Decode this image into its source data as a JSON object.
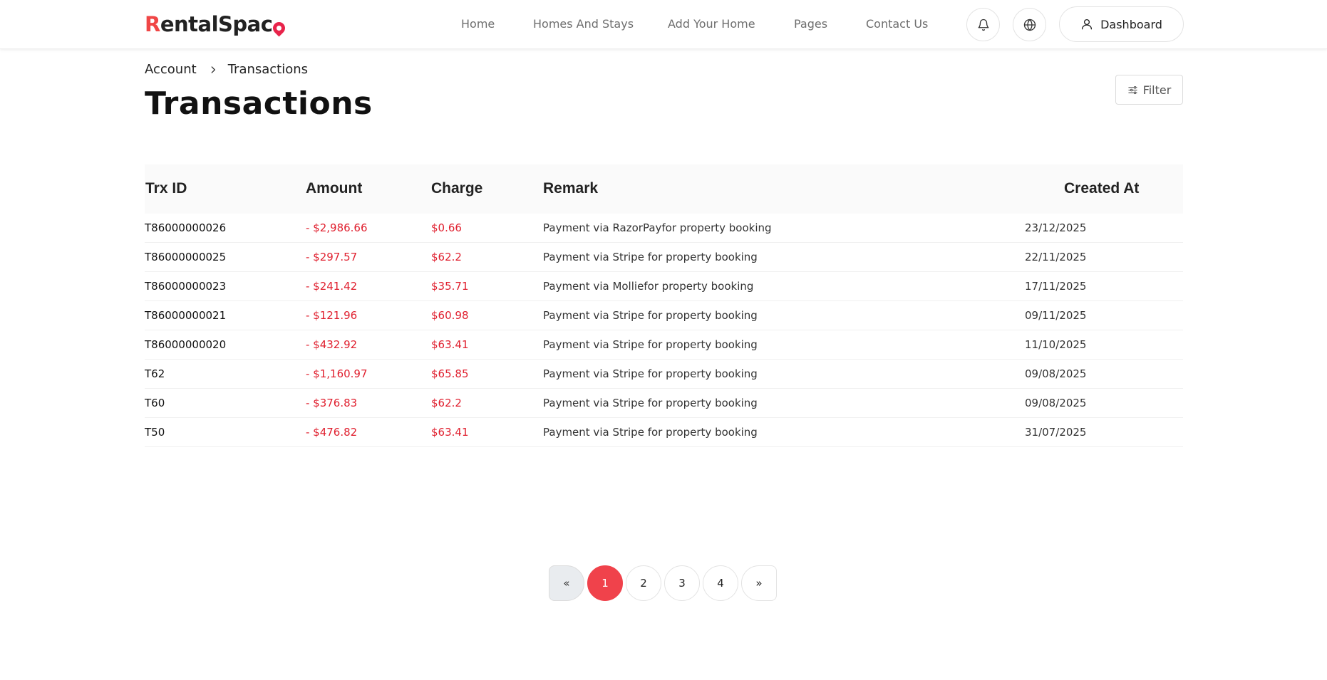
{
  "header": {
    "logo": {
      "first": "R",
      "rest": "entalSpac",
      "pin_color": "#e8234a"
    },
    "nav": [
      {
        "label": "Home"
      },
      {
        "label": "Homes And Stays"
      },
      {
        "label": "Add Your Home"
      },
      {
        "label": "Pages"
      },
      {
        "label": "Contact Us"
      }
    ],
    "notification_icon": "bell-icon",
    "language_icon": "globe-icon",
    "dashboard_label": "Dashboard"
  },
  "breadcrumb": {
    "parent": "Account",
    "current": "Transactions"
  },
  "page_title": "Transactions",
  "filter_label": "Filter",
  "table": {
    "columns": [
      "Trx ID",
      "Amount",
      "Charge",
      "Remark",
      "Created At"
    ],
    "rows": [
      {
        "id": "T86000000026",
        "amount": "- $2,986.66",
        "charge": "$0.66",
        "remark": "Payment via RazorPayfor property booking",
        "created": "23/12/2025"
      },
      {
        "id": "T86000000025",
        "amount": "- $297.57",
        "charge": "$62.2",
        "remark": "Payment via Stripe for property booking",
        "created": "22/11/2025"
      },
      {
        "id": "T86000000023",
        "amount": "- $241.42",
        "charge": "$35.71",
        "remark": "Payment via Molliefor property booking",
        "created": "17/11/2025"
      },
      {
        "id": "T86000000021",
        "amount": "- $121.96",
        "charge": "$60.98",
        "remark": "Payment via Stripe for property booking",
        "created": "09/11/2025"
      },
      {
        "id": "T86000000020",
        "amount": "- $432.92",
        "charge": "$63.41",
        "remark": "Payment via Stripe for property booking",
        "created": "11/10/2025"
      },
      {
        "id": "T62",
        "amount": "- $1,160.97",
        "charge": "$65.85",
        "remark": "Payment via Stripe for property booking",
        "created": "09/08/2025"
      },
      {
        "id": "T60",
        "amount": "- $376.83",
        "charge": "$62.2",
        "remark": "Payment via Stripe for property booking",
        "created": "09/08/2025"
      },
      {
        "id": "T50",
        "amount": "- $476.82",
        "charge": "$63.41",
        "remark": "Payment via Stripe for property booking",
        "created": "31/07/2025"
      }
    ]
  },
  "pagination": {
    "prev": "«",
    "pages": [
      "1",
      "2",
      "3",
      "4"
    ],
    "current": "1",
    "next": "»"
  },
  "colors": {
    "accent": "#f0424b",
    "negative": "#e0202f"
  }
}
